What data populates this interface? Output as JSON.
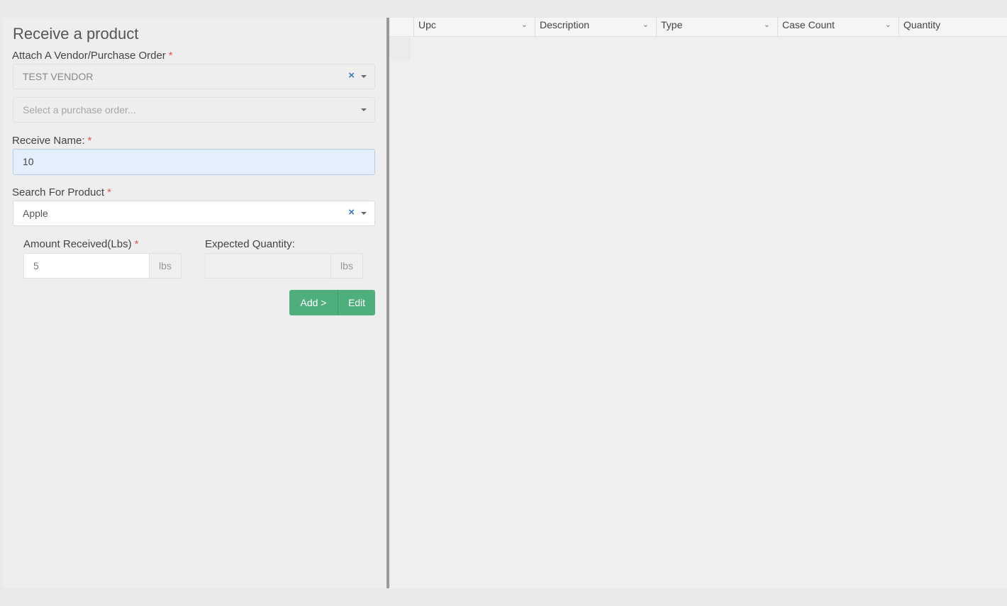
{
  "form": {
    "title": "Receive a product",
    "vendor_label": "Attach A Vendor/Purchase Order",
    "vendor_value": "TEST VENDOR",
    "purchase_order_placeholder": "Select a purchase order...",
    "receive_name_label": "Receive Name:",
    "receive_name_value": "10",
    "product_label": "Search For Product",
    "product_value": "Apple",
    "amount_label": "Amount Received(Lbs)",
    "amount_value": "5",
    "amount_unit": "lbs",
    "expected_label": "Expected Quantity:",
    "expected_value": "",
    "expected_unit": "lbs",
    "required_mark": "*",
    "add_button": "Add >",
    "edit_button": "Edit",
    "clear_icon": "×"
  },
  "grid": {
    "columns": [
      "Upc",
      "Description",
      "Type",
      "Case Count",
      "Quantity"
    ],
    "chevron": "⌄"
  },
  "colors": {
    "accent_green": "#4eae7c",
    "required_red": "#e2554f",
    "clear_blue": "#3a7abf"
  }
}
